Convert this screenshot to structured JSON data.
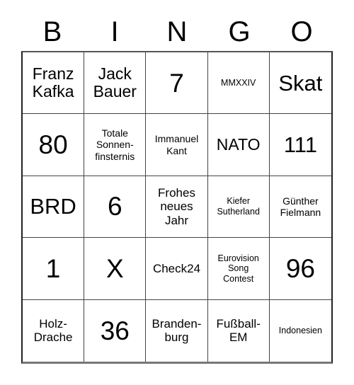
{
  "card": {
    "type": "bingo-card",
    "language": "de",
    "columns": 5,
    "rows": 5,
    "header": {
      "letters": [
        "B",
        "I",
        "N",
        "G",
        "O"
      ]
    },
    "cells": [
      {
        "text": "Franz\nKafka",
        "size": "sz-md",
        "row": 1,
        "col": "B"
      },
      {
        "text": "Jack\nBauer",
        "size": "sz-md",
        "row": 1,
        "col": "I"
      },
      {
        "text": "7",
        "size": "sz-xl",
        "row": 1,
        "col": "N"
      },
      {
        "text": "MMXXIV",
        "size": "sz-xxs",
        "row": 1,
        "col": "G"
      },
      {
        "text": "Skat",
        "size": "sz-lg",
        "row": 1,
        "col": "O"
      },
      {
        "text": "80",
        "size": "sz-xl",
        "row": 2,
        "col": "B"
      },
      {
        "text": "Totale\nSonnen-\nfinsternis",
        "size": "sz-xs",
        "row": 2,
        "col": "I"
      },
      {
        "text": "Immanuel\nKant",
        "size": "sz-xs",
        "row": 2,
        "col": "N"
      },
      {
        "text": "NATO",
        "size": "sz-md",
        "row": 2,
        "col": "G"
      },
      {
        "text": "111",
        "size": "sz-lg",
        "row": 2,
        "col": "O"
      },
      {
        "text": "BRD",
        "size": "sz-lg",
        "row": 3,
        "col": "B"
      },
      {
        "text": "6",
        "size": "sz-xl",
        "row": 3,
        "col": "I"
      },
      {
        "text": "Frohes\nneues\nJahr",
        "size": "sz-sm",
        "row": 3,
        "col": "N"
      },
      {
        "text": "Kiefer\nSutherland",
        "size": "sz-xxs",
        "row": 3,
        "col": "G"
      },
      {
        "text": "Günther\nFielmann",
        "size": "sz-xs",
        "row": 3,
        "col": "O"
      },
      {
        "text": "1",
        "size": "sz-xl",
        "row": 4,
        "col": "B"
      },
      {
        "text": "X",
        "size": "sz-xl",
        "row": 4,
        "col": "I"
      },
      {
        "text": "Check24",
        "size": "sz-sm",
        "row": 4,
        "col": "N"
      },
      {
        "text": "Eurovision\nSong\nContest",
        "size": "sz-xxs",
        "row": 4,
        "col": "G"
      },
      {
        "text": "96",
        "size": "sz-xl",
        "row": 4,
        "col": "O"
      },
      {
        "text": "Holz-\nDrache",
        "size": "sz-sm",
        "row": 5,
        "col": "B"
      },
      {
        "text": "36",
        "size": "sz-xl",
        "row": 5,
        "col": "I"
      },
      {
        "text": "Branden-\nburg",
        "size": "sz-sm",
        "row": 5,
        "col": "N"
      },
      {
        "text": "Fußball-\nEM",
        "size": "sz-sm",
        "row": 5,
        "col": "G"
      },
      {
        "text": "Indonesien",
        "size": "sz-xxs",
        "row": 5,
        "col": "O"
      }
    ],
    "colors": {
      "background": "#ffffff",
      "text": "#000000",
      "grid_line": "#444444",
      "outer_border": "#222222"
    }
  }
}
